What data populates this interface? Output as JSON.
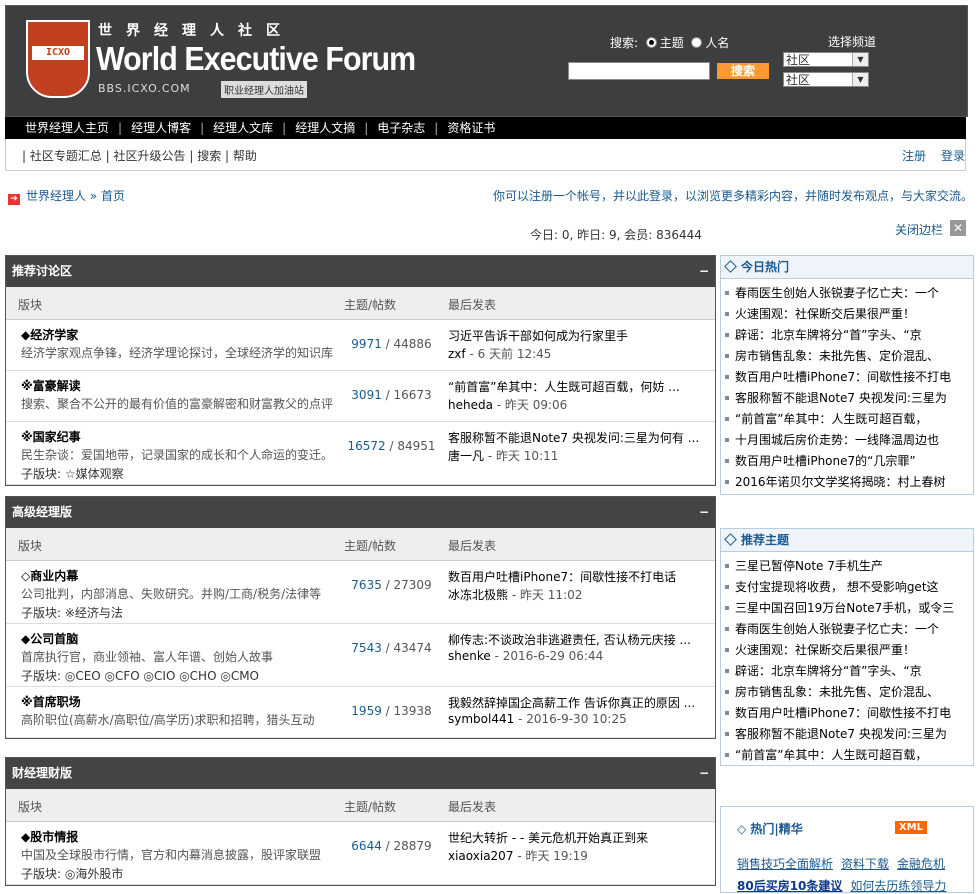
{
  "header": {
    "logo_text": "ICXO",
    "cn_title": "世界经理人社区",
    "en_title": "World Executive Forum",
    "domain": "BBS.ICXO.COM",
    "domain_sub": "职业经理人加油站",
    "search_label": "搜索:",
    "radio_topic": "主题",
    "radio_user": "人名",
    "search_button": "搜索",
    "channel_label": "选择频道",
    "channel_select_1": "社区",
    "channel_select_2": "社区"
  },
  "nav1": [
    "世界经理人主页",
    "经理人博客",
    "经理人文库",
    "经理人文摘",
    "电子杂志",
    "资格证书"
  ],
  "nav2": {
    "links": "| 社区专题汇总 | 社区升级公告 | 搜索 | 帮助",
    "register": "注册",
    "login": "登录"
  },
  "breadcrumb": "世界经理人 » 首页",
  "notice": "你可以注册一个帐号，并以此登录，以浏览更多精彩内容，并随时发布观点，与大家交流。",
  "stats": "今日: 0, 昨日: 9, 会员: 836444",
  "close_sidebar": "关闭边栏",
  "columns": {
    "board": "版块",
    "counts": "主题/帖数",
    "last": "最后发表"
  },
  "sections": [
    {
      "title": "推荐讨论区",
      "rows": [
        {
          "name": "◆经济学家",
          "desc": "经济学家观点争锋，经济学理论探讨，全球经济学的知识库",
          "sub": "",
          "topics": "9971",
          "posts": "44886",
          "last_title": "习近平告诉干部如何成为行家里手",
          "last_user": "zxf",
          "last_time": "6 天前 12:45"
        },
        {
          "name": "※富豪解读",
          "desc": "搜索、聚合不公开的最有价值的富豪解密和财富教父的点评",
          "sub": "",
          "topics": "3091",
          "posts": "16673",
          "last_title": "“前首富”牟其中：人生既可超百载，何妨 ...",
          "last_user": "heheda",
          "last_time": "昨天 09:06"
        },
        {
          "name": "※国家纪事",
          "desc": "民生杂谈：爱国地带，记录国家的成长和个人命运的变迁。",
          "sub": "子版块: ☆媒体观察",
          "topics": "16572",
          "posts": "84951",
          "last_title": "客服称暂不能退Note7 央视发问:三星为何有 ...",
          "last_user": "唐一凡",
          "last_time": "昨天 10:11"
        }
      ]
    },
    {
      "title": "高级经理版",
      "rows": [
        {
          "name": "◇商业内幕",
          "desc": "公司批判，内部消息、失败研究。并购/工商/税务/法律等",
          "sub": "子版块: ※经济与法",
          "topics": "7635",
          "posts": "27309",
          "last_title": "数百用户吐槽iPhone7：间歇性接不打电话",
          "last_user": "冰冻北极熊",
          "last_time": "昨天 11:02"
        },
        {
          "name": "◆公司首脑",
          "desc": "首席执行官，商业领袖、富人年谱、创始人故事",
          "sub": "子版块: ◎CEO  ◎CFO  ◎CIO  ◎CHO  ◎CMO",
          "topics": "7543",
          "posts": "43474",
          "last_title": "柳传志:不谈政治非逃避责任, 否认杨元庆接 ...",
          "last_user": "shenke",
          "last_time": "2016-6-29 06:44"
        },
        {
          "name": "※首席职场",
          "desc": "高阶职位(高薪水/高职位/高学历)求职和招聘，猎头互动",
          "sub": "",
          "topics": "1959",
          "posts": "13938",
          "last_title": "我毅然辞掉国企高薪工作 告诉你真正的原因 ...",
          "last_user": "symbol441",
          "last_time": "2016-9-30 10:25"
        }
      ]
    },
    {
      "title": "财经理财版",
      "rows": [
        {
          "name": "◆股市情报",
          "desc": "中国及全球股市行情，官方和内幕消息披露，股评家联盟",
          "sub": "子版块: ◎海外股市",
          "topics": "6644",
          "posts": "28879",
          "last_title": "世纪大转折 - - 美元危机开始真正到来",
          "last_user": "xiaoxia207",
          "last_time": "昨天 19:19"
        }
      ]
    }
  ],
  "side_hot": {
    "title": "今日热门",
    "items": [
      "春雨医生创始人张锐妻子忆亡夫：一个",
      "火速围观：社保断交后果很严重！",
      "辟谣：北京车牌将分“首”字头、“京",
      "房市销售乱象：未批先售、定价混乱、",
      "数百用户吐槽iPhone7：间歇性接不打电",
      "客服称暂不能退Note7 央视发问:三星为",
      "“前首富”牟其中：人生既可超百载，",
      "十月围城后房价走势：一线降温周边也",
      "数百用户吐槽iPhone7的“几宗罪”",
      "2016年诺贝尔文学奖将揭晓：村上春树"
    ]
  },
  "side_rec": {
    "title": "推荐主题",
    "items": [
      "三星已暂停Note 7手机生产",
      "支付宝提现将收费， 想不受影响get这",
      "三星中国召回19万台Note7手机，或令三",
      "春雨医生创始人张锐妻子忆亡夫：一个",
      "火速围观：社保断交后果很严重！",
      "辟谣：北京车牌将分“首”字头、“京",
      "房市销售乱象：未批先售、定价混乱、",
      "数百用户吐槽iPhone7：间歇性接不打电",
      "客服称暂不能退Note7 央视发问:三星为",
      "“前首富”牟其中：人生既可超百载，"
    ]
  },
  "side_hot2": {
    "title": "热门|精华",
    "xml": "XML",
    "row1": [
      "销售技巧全面解析",
      "资料下载",
      "金融危机"
    ],
    "row2": [
      "80后买房10条建议",
      "如何去历练领导力"
    ]
  }
}
